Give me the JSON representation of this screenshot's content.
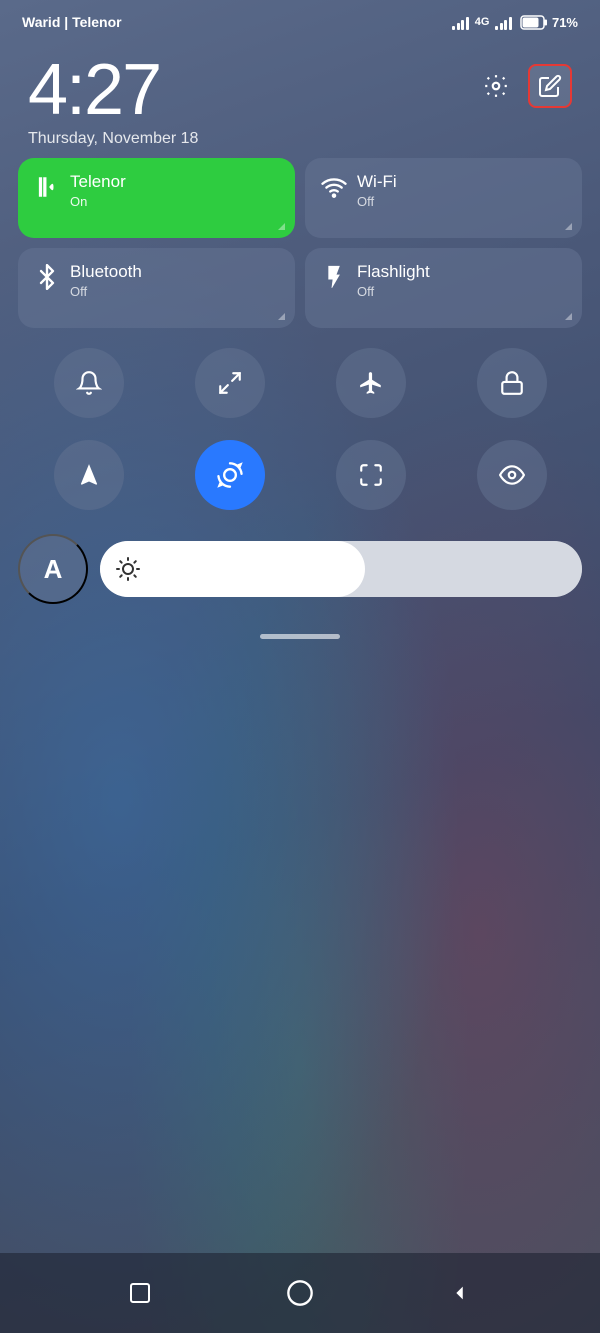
{
  "statusBar": {
    "carrier": "Warid | Telenor",
    "networkType": "4G",
    "batteryPercent": "71%"
  },
  "clock": {
    "time": "4:27",
    "date": "Thursday, November 18"
  },
  "quickSettings": {
    "tiles": [
      {
        "id": "telenor",
        "label": "Telenor",
        "status": "On",
        "active": true,
        "icon": "signal"
      },
      {
        "id": "wifi",
        "label": "Wi-Fi",
        "status": "Off",
        "active": false,
        "icon": "wifi"
      },
      {
        "id": "bluetooth",
        "label": "Bluetooth",
        "status": "Off",
        "active": false,
        "icon": "bluetooth"
      },
      {
        "id": "flashlight",
        "label": "Flashlight",
        "status": "Off",
        "active": false,
        "icon": "flashlight"
      }
    ]
  },
  "toggles": {
    "row1": [
      {
        "id": "bell",
        "icon": "bell",
        "active": false
      },
      {
        "id": "screenshot",
        "icon": "screenshot",
        "active": false
      },
      {
        "id": "airplane",
        "icon": "airplane",
        "active": false
      },
      {
        "id": "lock",
        "icon": "lock",
        "active": false
      }
    ],
    "row2": [
      {
        "id": "location",
        "icon": "location",
        "active": false
      },
      {
        "id": "autorotate",
        "icon": "autorotate",
        "active": true
      },
      {
        "id": "fullscreen",
        "icon": "fullscreen",
        "active": false
      },
      {
        "id": "eye",
        "icon": "eye",
        "active": false
      }
    ]
  },
  "brightness": {
    "level": 55,
    "icon": "sun"
  },
  "fontButton": {
    "label": "A"
  },
  "editButton": {
    "label": "✏"
  },
  "settingsButton": {
    "label": "⚙"
  },
  "navbar": {
    "items": [
      {
        "id": "square",
        "icon": "square"
      },
      {
        "id": "home",
        "icon": "circle"
      },
      {
        "id": "back",
        "icon": "triangle"
      }
    ]
  }
}
